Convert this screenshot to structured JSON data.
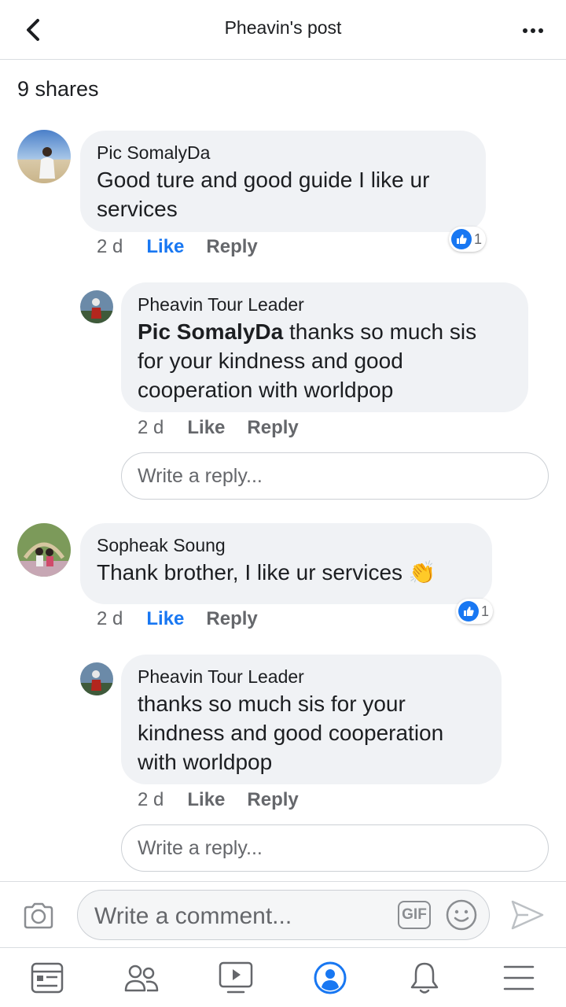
{
  "header": {
    "title": "Pheavin's post",
    "back_icon": "chevron-left-icon",
    "more_icon": "more-horizontal-icon"
  },
  "shares_text": "9 shares",
  "comments": [
    {
      "author": "Pic SomalyDa",
      "text_lines": [
        "Good ture and good guide I like ur",
        "services"
      ],
      "time": "2 d",
      "like_label": "Like",
      "reply_label": "Reply",
      "liked": true,
      "reaction_count": "1",
      "replies": [
        {
          "author": "Pheavin Tour Leader",
          "tag": "Pic SomalyDa",
          "text_lines": [
            " thanks so much sis",
            "for your kindness and good",
            "cooperation with worldpop"
          ],
          "time": "2 d",
          "like_label": "Like",
          "reply_label": "Reply"
        }
      ],
      "write_reply_placeholder": "Write a reply..."
    },
    {
      "author": "Sopheak Soung",
      "text": "Thank brother, I like ur services ",
      "emoji": "👏",
      "time": "2 d",
      "like_label": "Like",
      "reply_label": "Reply",
      "liked": true,
      "reaction_count": "1",
      "replies": [
        {
          "author": "Pheavin Tour Leader",
          "text_lines": [
            "thanks so much sis for your",
            "kindness and good cooperation",
            "with worldpop"
          ],
          "time": "2 d",
          "like_label": "Like",
          "reply_label": "Reply"
        }
      ],
      "write_reply_placeholder": "Write a reply..."
    }
  ],
  "composer": {
    "placeholder": "Write a comment...",
    "gif_label": "GIF",
    "camera_icon": "camera-icon",
    "emoji_icon": "smiley-icon",
    "send_icon": "send-icon"
  },
  "bottom_nav": {
    "items": [
      "news-feed-icon",
      "friends-icon",
      "watch-icon",
      "profile-icon",
      "notifications-icon",
      "menu-icon"
    ],
    "active": "profile-icon"
  },
  "colors": {
    "accent": "#1877f2",
    "bubble": "#f0f2f5",
    "secondary_text": "#65676b"
  }
}
